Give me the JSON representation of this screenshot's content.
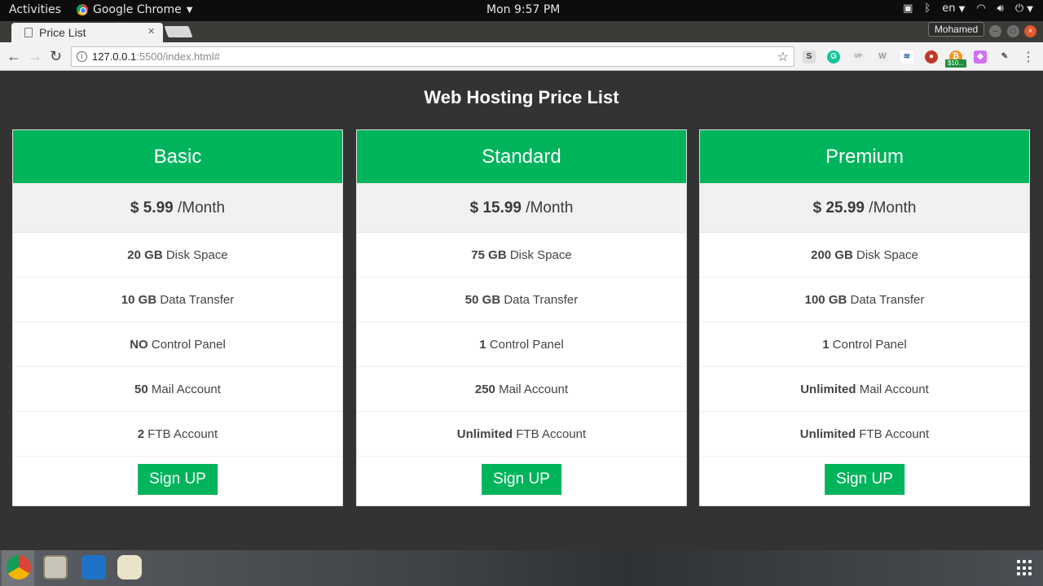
{
  "system": {
    "activities": "Activities",
    "app_name": "Google Chrome",
    "clock": "Mon  9:57 PM",
    "language": "en"
  },
  "browser": {
    "tab_title": "Price List",
    "profile_name": "Mohamed",
    "url_host": "127.0.0.1",
    "url_rest": ":5500/index.html#",
    "extension_badge": "$10..."
  },
  "page": {
    "title": "Web Hosting Price List",
    "accent_color": "#00b45c",
    "background_color": "#333333"
  },
  "plans": [
    {
      "name": "Basic",
      "price": "$ 5.99",
      "period": " /Month",
      "features": [
        {
          "value": "20 GB",
          "label": " Disk Space"
        },
        {
          "value": "10 GB",
          "label": " Data Transfer"
        },
        {
          "value": "NO",
          "label": " Control Panel"
        },
        {
          "value": "50",
          "label": " Mail Account"
        },
        {
          "value": "2",
          "label": " FTB Account"
        }
      ],
      "button": "Sign UP"
    },
    {
      "name": "Standard",
      "price": "$ 15.99",
      "period": " /Month",
      "features": [
        {
          "value": "75 GB",
          "label": " Disk Space"
        },
        {
          "value": "50 GB",
          "label": " Data Transfer"
        },
        {
          "value": "1",
          "label": " Control Panel"
        },
        {
          "value": "250",
          "label": " Mail Account"
        },
        {
          "value": "Unlimited",
          "label": " FTB Account"
        }
      ],
      "button": "Sign UP"
    },
    {
      "name": "Premium",
      "price": "$ 25.99",
      "period": " /Month",
      "features": [
        {
          "value": "200 GB",
          "label": " Disk Space"
        },
        {
          "value": "100 GB",
          "label": " Data Transfer"
        },
        {
          "value": "1",
          "label": " Control Panel"
        },
        {
          "value": "Unlimited",
          "label": " Mail Account"
        },
        {
          "value": "Unlimited",
          "label": " FTB Account"
        }
      ],
      "button": "Sign UP"
    }
  ]
}
